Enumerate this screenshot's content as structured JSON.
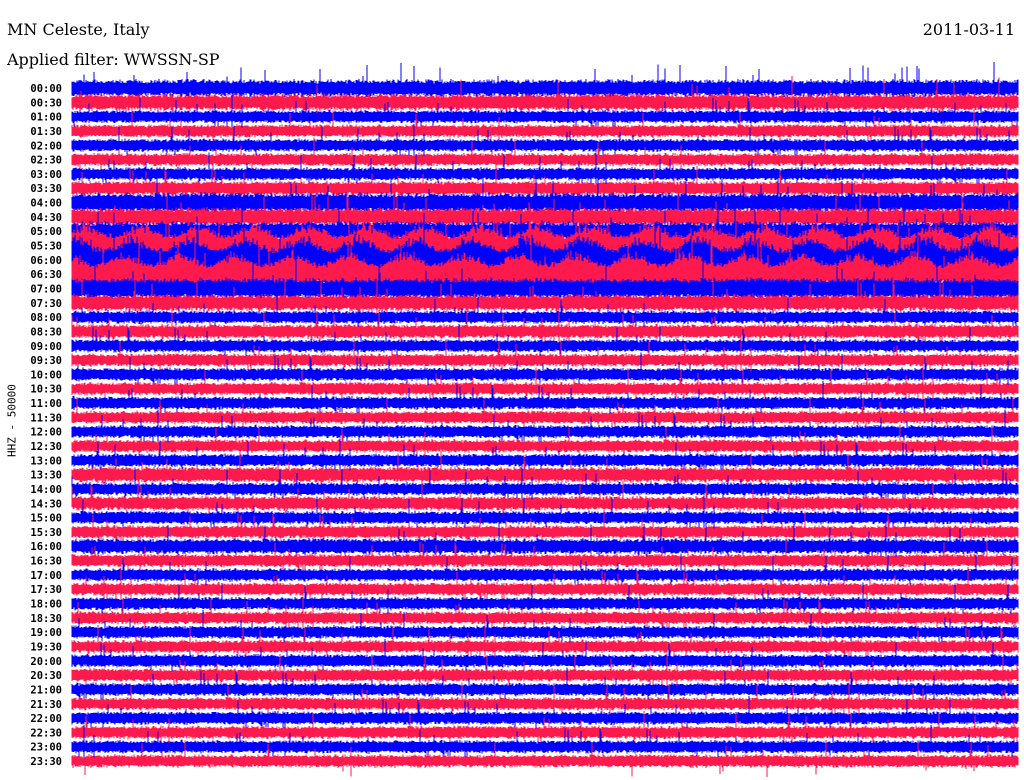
{
  "header": {
    "station": "MN Celeste, Italy",
    "filter": "Applied filter: WWSSN-SP",
    "date": "2011-03-11"
  },
  "chart_data": {
    "type": "line",
    "title": "MN Celeste, Italy",
    "subtitle": "Applied filter: WWSSN-SP",
    "ylabel": "HHZ - 50000",
    "xlabel": "",
    "colors": [
      "#0000ff",
      "#ff1a4d"
    ],
    "row_labels": [
      "00:00",
      "00:30",
      "01:00",
      "01:30",
      "02:00",
      "02:30",
      "03:00",
      "03:30",
      "04:00",
      "04:30",
      "05:00",
      "05:30",
      "06:00",
      "06:30",
      "07:00",
      "07:30",
      "08:00",
      "08:30",
      "09:00",
      "09:30",
      "10:00",
      "10:30",
      "11:00",
      "11:30",
      "12:00",
      "12:30",
      "13:00",
      "13:30",
      "14:00",
      "14:30",
      "15:00",
      "15:30",
      "16:00",
      "16:30",
      "17:00",
      "17:30",
      "18:00",
      "18:30",
      "19:00",
      "19:30",
      "20:00",
      "20:30",
      "21:00",
      "21:30",
      "22:00",
      "22:30",
      "23:00",
      "23:30"
    ],
    "relative_activity": [
      1.3,
      1.3,
      1.0,
      1.0,
      1.0,
      1.0,
      1.0,
      1.1,
      1.5,
      1.4,
      1.5,
      2.6,
      2.8,
      2.6,
      1.6,
      1.3,
      1.0,
      1.1,
      1.0,
      1.0,
      1.0,
      1.0,
      1.0,
      1.0,
      1.0,
      1.0,
      1.0,
      1.2,
      1.0,
      1.1,
      1.0,
      1.0,
      1.2,
      1.0,
      1.0,
      1.0,
      1.0,
      1.0,
      1.0,
      1.0,
      1.0,
      1.0,
      1.0,
      1.0,
      1.0,
      1.0,
      1.0,
      1.0
    ],
    "grid": false,
    "legend": "none"
  }
}
